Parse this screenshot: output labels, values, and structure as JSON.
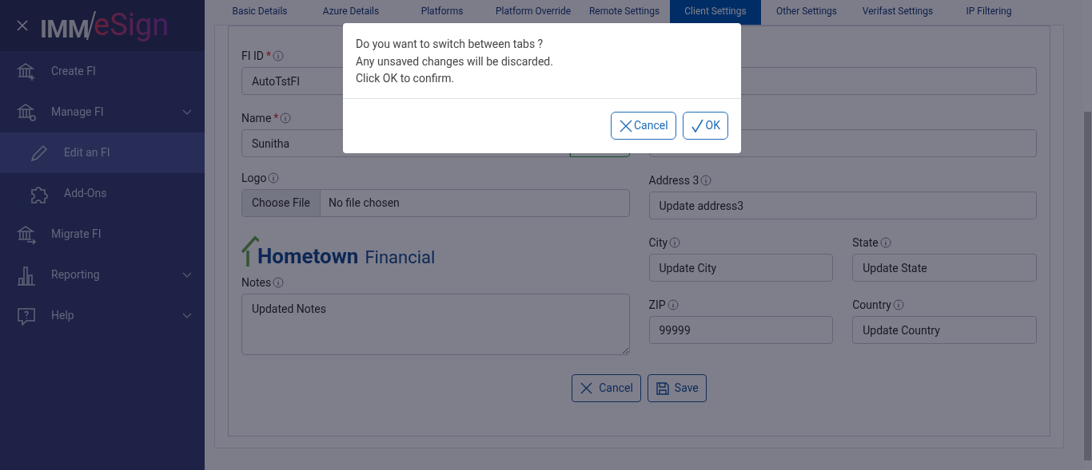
{
  "sidebar": {
    "logo": {
      "left": "IMM",
      "right": "eSign"
    },
    "items": [
      {
        "kind": "create",
        "label": "Create FI",
        "selected": false,
        "has_submenu": false
      },
      {
        "kind": "manage",
        "label": "Manage FI",
        "selected": false,
        "has_submenu": true,
        "children": [
          {
            "kind": "edit",
            "label": "Edit an FI",
            "selected": true
          },
          {
            "kind": "addons",
            "label": "Add-Ons",
            "selected": false
          }
        ]
      },
      {
        "kind": "migrate",
        "label": "Migrate FI",
        "selected": false,
        "has_submenu": false
      },
      {
        "kind": "reporting",
        "label": "Reporting",
        "selected": false,
        "has_submenu": true
      },
      {
        "kind": "help",
        "label": "Help",
        "selected": false,
        "has_submenu": true
      }
    ]
  },
  "tabs": [
    {
      "label": "Basic Details",
      "selected": false
    },
    {
      "label": "Azure Details",
      "selected": false
    },
    {
      "label": "Platforms",
      "selected": false
    },
    {
      "label": "Platform Override",
      "selected": false
    },
    {
      "label": "Remote Settings",
      "selected": false
    },
    {
      "label": "Client Settings",
      "selected": true
    },
    {
      "label": "Other Settings",
      "selected": false
    },
    {
      "label": "Verifast Settings",
      "selected": false
    },
    {
      "label": "IP Filtering",
      "selected": false
    }
  ],
  "form": {
    "fi_id": {
      "label": "FI ID",
      "required_mark": "*",
      "value": "AutoTstFI"
    },
    "name": {
      "label": "Name",
      "required_mark": "*",
      "value": "Sunitha"
    },
    "logo": {
      "label": "Logo",
      "button": "Choose File",
      "value": "No file chosen"
    },
    "brand": {
      "primary": "Hometown",
      "secondary": "Financial"
    },
    "notes": {
      "label": "Notes",
      "value": "Updated Notes"
    },
    "address_3": {
      "label": "Address 3",
      "value": "Update address3"
    },
    "city": {
      "label": "City",
      "value": "Update City"
    },
    "state": {
      "label": "State",
      "value": "Update State"
    },
    "zip": {
      "label": "ZIP",
      "value": "99999"
    },
    "country": {
      "label": "Country",
      "value": "Update Country"
    },
    "buttons": [
      "Cancel",
      "Save"
    ]
  },
  "dialog": {
    "lines": [
      "Do you want to switch between tabs ?",
      "Any unsaved changes will be discarded.",
      "Click OK to confirm."
    ],
    "buttons": [
      "Cancel",
      "OK"
    ]
  }
}
